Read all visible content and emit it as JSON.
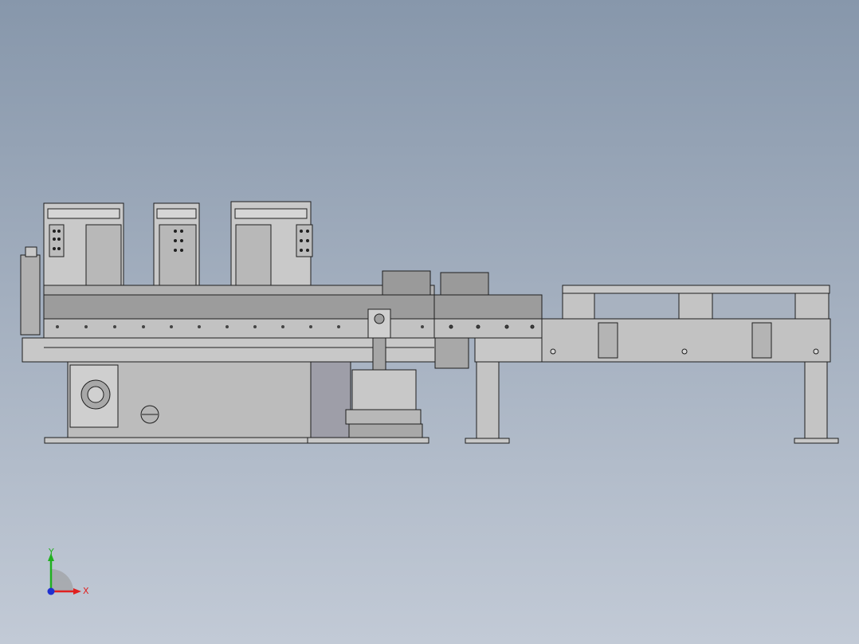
{
  "viewport": {
    "background_top": "#8797ab",
    "background_bottom": "#c2cad6"
  },
  "model": {
    "fill_light": "#cfcfcf",
    "fill_mid": "#b4b4b4",
    "fill_dark": "#8e8e8e",
    "outline": "#1e1e1e"
  },
  "triad": {
    "x_label": "X",
    "y_label": "Y",
    "x_color": "#e02020",
    "y_color": "#20b020",
    "z_color": "#2030d0"
  }
}
